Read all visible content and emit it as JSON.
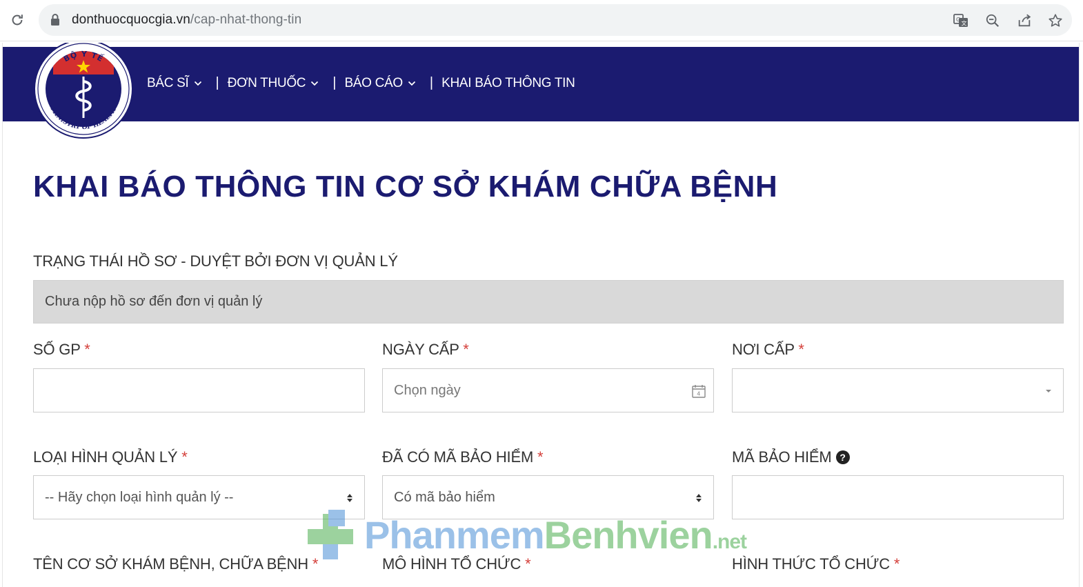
{
  "browser": {
    "url_host": "donthuocquocgia.vn",
    "url_path": "/cap-nhat-thong-tin"
  },
  "logo": {
    "top_text": "BỘ Y TẾ",
    "bottom_text": "MINISTRY OF HEALTH"
  },
  "nav": {
    "items": [
      {
        "label": "BÁC SĨ",
        "has_dropdown": true
      },
      {
        "label": "ĐƠN THUỐC",
        "has_dropdown": true
      },
      {
        "label": "BÁO CÁO",
        "has_dropdown": true
      },
      {
        "label": "KHAI BÁO THÔNG TIN",
        "has_dropdown": false
      }
    ],
    "separator": "|"
  },
  "page": {
    "title": "KHAI BÁO THÔNG TIN CƠ SỞ KHÁM CHỮA BỆNH",
    "status_label": "TRẠNG THÁI HỒ SƠ - DUYỆT BỞI ĐƠN VỊ QUẢN LÝ",
    "status_value": "Chưa nộp hồ sơ đến đơn vị quản lý",
    "required_mark": "*"
  },
  "form": {
    "so_gp": {
      "label": "SỐ GP",
      "value": ""
    },
    "ngay_cap": {
      "label": "NGÀY CẤP",
      "placeholder": "Chọn ngày"
    },
    "noi_cap": {
      "label": "NƠI CẤP",
      "value": ""
    },
    "loai_hinh": {
      "label": "LOẠI HÌNH QUẢN LÝ",
      "value": "-- Hãy chọn loại hình quản lý --"
    },
    "da_co_ma": {
      "label": "ĐÃ CÓ MÃ BẢO HIỂM",
      "value": "Có mã bảo hiểm"
    },
    "ma_bao_hiem": {
      "label": "MÃ BẢO HIỂM",
      "value": ""
    },
    "ten_co_so": {
      "label": "TÊN CƠ SỞ KHÁM BỆNH, CHỮA BỆNH"
    },
    "mo_hinh": {
      "label": "MÔ HÌNH TỔ CHỨC"
    },
    "hinh_thuc": {
      "label": "HÌNH THỨC TỔ CHỨC"
    }
  },
  "watermark": {
    "part1": "Phanmem",
    "part2": "Benhvien",
    "part3": ".net"
  },
  "colors": {
    "navbar": "#1b1b70",
    "title": "#1b1b70",
    "required": "#d43f3a",
    "status_bg": "#d9d9d9"
  }
}
